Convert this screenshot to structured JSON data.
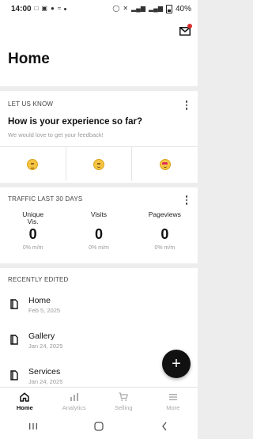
{
  "status_bar": {
    "time": "14:00",
    "battery": "40%"
  },
  "header": {
    "title": "Home"
  },
  "feedback_card": {
    "label": "LET US KNOW",
    "question": "How is your experience so far?",
    "subtitle": "We would love to get your feedback!",
    "emojis": [
      "neutral-face-icon",
      "slight-smile-icon",
      "heart-eyes-icon"
    ]
  },
  "traffic_card": {
    "label": "TRAFFIC LAST 30 DAYS",
    "stats": [
      {
        "label": "Unique Vis.",
        "value": "0",
        "change": "0% m/m"
      },
      {
        "label": "Visits",
        "value": "0",
        "change": "0% m/m"
      },
      {
        "label": "Pageviews",
        "value": "0",
        "change": "0% m/m"
      }
    ]
  },
  "recent_card": {
    "label": "RECENTLY EDITED",
    "items": [
      {
        "name": "Home",
        "date": "Feb 5, 2025"
      },
      {
        "name": "Gallery",
        "date": "Jan 24, 2025"
      },
      {
        "name": "Services",
        "date": "Jan 24, 2025"
      }
    ]
  },
  "fab": {
    "label": "+"
  },
  "bottom_nav": [
    {
      "label": "Home",
      "icon": "home-icon",
      "active": true
    },
    {
      "label": "Analytics",
      "icon": "bar-chart-icon",
      "active": false
    },
    {
      "label": "Selling",
      "icon": "cart-icon",
      "active": false
    },
    {
      "label": "More",
      "icon": "menu-icon",
      "active": false
    }
  ],
  "colors": {
    "accent": "#111111",
    "notification": "#d92e2e",
    "muted": "#999999",
    "background": "#ededed"
  }
}
